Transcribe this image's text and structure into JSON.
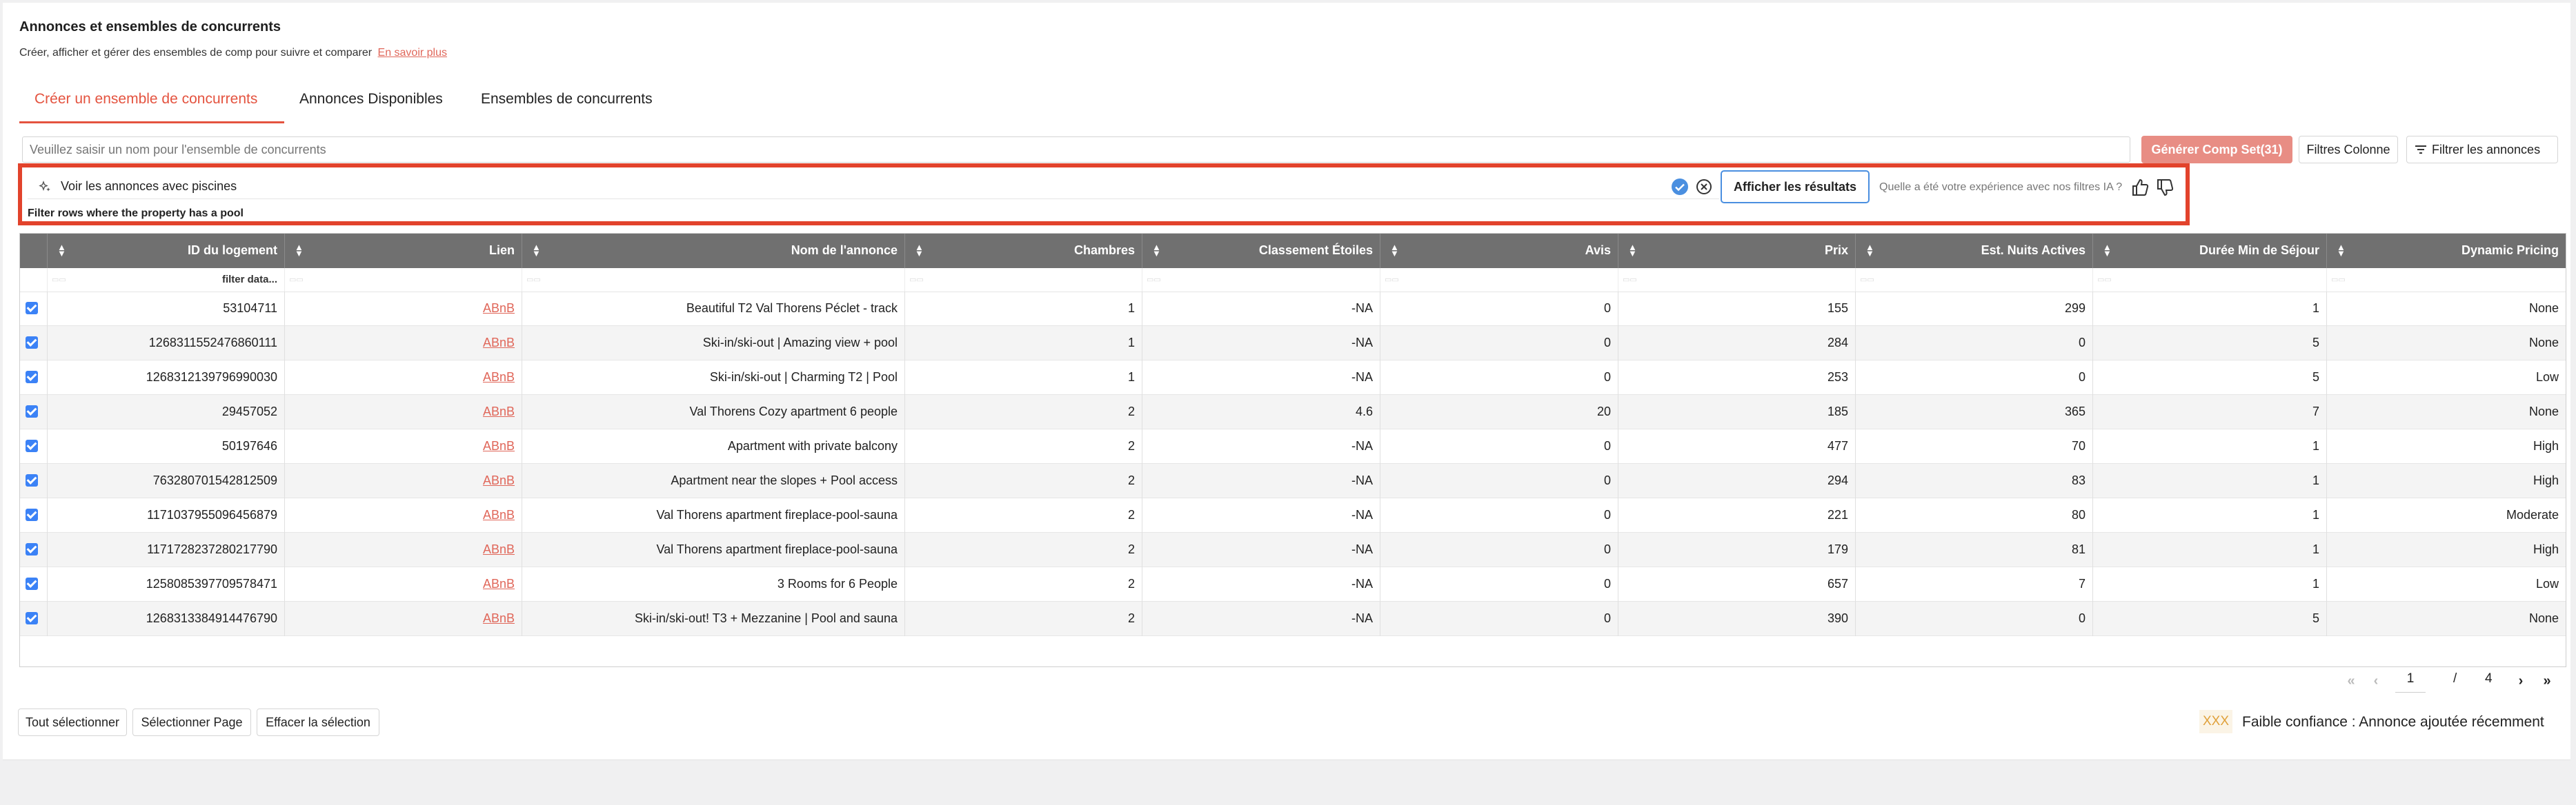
{
  "header": {
    "title": "Annonces et ensembles de concurrents",
    "subtitle": "Créer, afficher et gérer des ensembles de comp pour suivre et comparer",
    "learn_more": "En savoir plus"
  },
  "tabs": [
    {
      "label": "Créer un ensemble de concurrents",
      "active": true
    },
    {
      "label": "Annonces Disponibles",
      "active": false
    },
    {
      "label": "Ensembles de concurrents",
      "active": false
    }
  ],
  "compset": {
    "name_placeholder": "Veuillez saisir un nom pour l'ensemble de concurrents",
    "generate_label": "Générer Comp Set(31)",
    "column_filters_label": "Filtres Colonne",
    "filter_listings_label": "Filtrer les annonces"
  },
  "ai_filter": {
    "query": "Voir les annonces avec piscines",
    "hint": "Filter rows where the property has a pool",
    "show_results_label": "Afficher les résultats",
    "feedback_question": "Quelle a été votre expérience avec nos filtres IA ?"
  },
  "table": {
    "columns": [
      "ID du logement",
      "Lien",
      "Nom de l'annonce",
      "Chambres",
      "Classement Étoiles",
      "Avis",
      "Prix",
      "Est. Nuits Actives",
      "Durée Min de Séjour",
      "Dynamic Pricing"
    ],
    "filter_placeholder": "filter data...",
    "rows": [
      {
        "checked": true,
        "id": "53104711",
        "link": "ABnB",
        "name": "Beautiful T2 Val Thorens Péclet - track",
        "bedrooms": "1",
        "stars": "-NA",
        "reviews": "0",
        "price": "155",
        "nights": "299",
        "min_stay": "1",
        "dynamic": "None"
      },
      {
        "checked": true,
        "id": "1268311552476860111",
        "link": "ABnB",
        "name": "Ski-in/ski-out | Amazing view + pool",
        "bedrooms": "1",
        "stars": "-NA",
        "reviews": "0",
        "price": "284",
        "nights": "0",
        "min_stay": "5",
        "dynamic": "None"
      },
      {
        "checked": true,
        "id": "1268312139796990030",
        "link": "ABnB",
        "name": "Ski-in/ski-out | Charming T2 | Pool",
        "bedrooms": "1",
        "stars": "-NA",
        "reviews": "0",
        "price": "253",
        "nights": "0",
        "min_stay": "5",
        "dynamic": "Low"
      },
      {
        "checked": true,
        "id": "29457052",
        "link": "ABnB",
        "name": "Val Thorens Cozy apartment 6 people",
        "bedrooms": "2",
        "stars": "4.6",
        "reviews": "20",
        "price": "185",
        "nights": "365",
        "min_stay": "7",
        "dynamic": "None"
      },
      {
        "checked": true,
        "id": "50197646",
        "link": "ABnB",
        "name": "Apartment with private balcony",
        "bedrooms": "2",
        "stars": "-NA",
        "reviews": "0",
        "price": "477",
        "nights": "70",
        "min_stay": "1",
        "dynamic": "High"
      },
      {
        "checked": true,
        "id": "763280701542812509",
        "link": "ABnB",
        "name": "Apartment near the slopes + Pool access",
        "bedrooms": "2",
        "stars": "-NA",
        "reviews": "0",
        "price": "294",
        "nights": "83",
        "min_stay": "1",
        "dynamic": "High"
      },
      {
        "checked": true,
        "id": "1171037955096456879",
        "link": "ABnB",
        "name": "Val Thorens apartment fireplace-pool-sauna",
        "bedrooms": "2",
        "stars": "-NA",
        "reviews": "0",
        "price": "221",
        "nights": "80",
        "min_stay": "1",
        "dynamic": "Moderate"
      },
      {
        "checked": true,
        "id": "1171728237280217790",
        "link": "ABnB",
        "name": "Val Thorens apartment fireplace-pool-sauna",
        "bedrooms": "2",
        "stars": "-NA",
        "reviews": "0",
        "price": "179",
        "nights": "81",
        "min_stay": "1",
        "dynamic": "High"
      },
      {
        "checked": true,
        "id": "1258085397709578471",
        "link": "ABnB",
        "name": "3 Rooms for 6 People",
        "bedrooms": "2",
        "stars": "-NA",
        "reviews": "0",
        "price": "657",
        "nights": "7",
        "min_stay": "1",
        "dynamic": "Low"
      },
      {
        "checked": true,
        "id": "1268313384914476790",
        "link": "ABnB",
        "name": "Ski-in/ski-out! T3 + Mezzanine | Pool and sauna",
        "bedrooms": "2",
        "stars": "-NA",
        "reviews": "0",
        "price": "390",
        "nights": "0",
        "min_stay": "5",
        "dynamic": "None"
      }
    ]
  },
  "pagination": {
    "current_page": "1",
    "separator": "/",
    "total_pages": "4"
  },
  "footer": {
    "select_all_label": "Tout sélectionner",
    "select_page_label": "Sélectionner Page",
    "clear_selection_label": "Effacer la sélection",
    "legend_badge": "XXX",
    "legend_text": "Faible confiance : Annonce ajoutée récemment"
  },
  "colors": {
    "accent": "#e4533f",
    "highlight_border": "#e2432c",
    "header_bg": "#707070",
    "checkbox": "#3b82f6",
    "generate_btn": "#e88d84"
  }
}
